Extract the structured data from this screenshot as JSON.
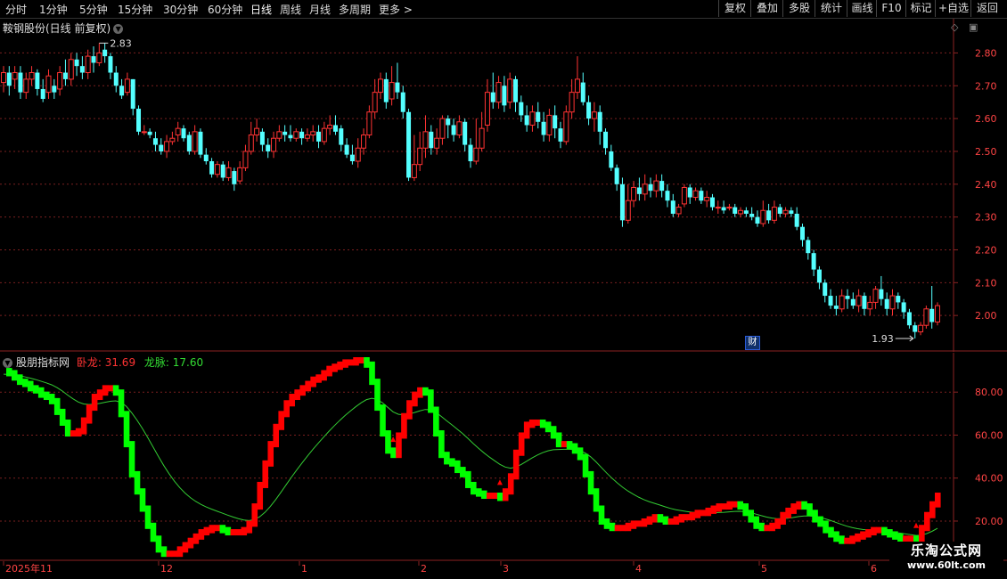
{
  "toolbar": {
    "periods": [
      "分时",
      "1分钟",
      "5分钟",
      "15分钟",
      "30分钟",
      "60分钟",
      "日线",
      "周线",
      "月线",
      "多周期",
      "更多 >"
    ],
    "active_period": "日线",
    "right_buttons": [
      "复权",
      "叠加",
      "多股",
      "统计",
      "画线",
      "F10",
      "标记",
      "+自选",
      "返回"
    ]
  },
  "main_chart": {
    "stock_title": "鞍钢股份(日线 前复权)",
    "high_label": "2.83",
    "low_label": "1.93",
    "marker_label": "财",
    "price_axis": [
      "2.80",
      "2.70",
      "2.60",
      "2.50",
      "2.40",
      "2.30",
      "2.20",
      "2.10",
      "2.00"
    ],
    "candles": [
      [
        2.71,
        2.74,
        2.68,
        2.76
      ],
      [
        2.74,
        2.7,
        2.67,
        2.76
      ],
      [
        2.72,
        2.74,
        2.69,
        2.76
      ],
      [
        2.74,
        2.68,
        2.66,
        2.76
      ],
      [
        2.68,
        2.72,
        2.66,
        2.74
      ],
      [
        2.72,
        2.74,
        2.7,
        2.76
      ],
      [
        2.74,
        2.69,
        2.67,
        2.75
      ],
      [
        2.69,
        2.66,
        2.65,
        2.72
      ],
      [
        2.68,
        2.73,
        2.66,
        2.75
      ],
      [
        2.7,
        2.68,
        2.66,
        2.72
      ],
      [
        2.69,
        2.74,
        2.67,
        2.76
      ],
      [
        2.74,
        2.72,
        2.7,
        2.78
      ],
      [
        2.72,
        2.78,
        2.7,
        2.8
      ],
      [
        2.78,
        2.76,
        2.73,
        2.8
      ],
      [
        2.76,
        2.74,
        2.72,
        2.79
      ],
      [
        2.74,
        2.79,
        2.72,
        2.81
      ],
      [
        2.79,
        2.77,
        2.74,
        2.82
      ],
      [
        2.77,
        2.8,
        2.76,
        2.83
      ],
      [
        2.81,
        2.79,
        2.77,
        2.83
      ],
      [
        2.79,
        2.74,
        2.72,
        2.8
      ],
      [
        2.74,
        2.7,
        2.68,
        2.76
      ],
      [
        2.7,
        2.67,
        2.66,
        2.72
      ],
      [
        2.68,
        2.72,
        2.67,
        2.74
      ],
      [
        2.72,
        2.63,
        2.61,
        2.72
      ],
      [
        2.63,
        2.56,
        2.55,
        2.64
      ],
      [
        2.56,
        2.56,
        2.55,
        2.58
      ],
      [
        2.56,
        2.55,
        2.54,
        2.57
      ],
      [
        2.54,
        2.52,
        2.5,
        2.56
      ],
      [
        2.52,
        2.5,
        2.49,
        2.54
      ],
      [
        2.5,
        2.53,
        2.48,
        2.55
      ],
      [
        2.53,
        2.54,
        2.52,
        2.56
      ],
      [
        2.55,
        2.57,
        2.53,
        2.59
      ],
      [
        2.57,
        2.54,
        2.53,
        2.58
      ],
      [
        2.55,
        2.5,
        2.49,
        2.56
      ],
      [
        2.5,
        2.56,
        2.49,
        2.58
      ],
      [
        2.56,
        2.49,
        2.48,
        2.57
      ],
      [
        2.49,
        2.47,
        2.46,
        2.51
      ],
      [
        2.47,
        2.43,
        2.42,
        2.48
      ],
      [
        2.43,
        2.46,
        2.42,
        2.47
      ],
      [
        2.46,
        2.42,
        2.41,
        2.47
      ],
      [
        2.42,
        2.45,
        2.41,
        2.47
      ],
      [
        2.44,
        2.4,
        2.38,
        2.45
      ],
      [
        2.41,
        2.45,
        2.4,
        2.47
      ],
      [
        2.45,
        2.5,
        2.44,
        2.52
      ],
      [
        2.5,
        2.55,
        2.49,
        2.59
      ],
      [
        2.55,
        2.57,
        2.53,
        2.6
      ],
      [
        2.56,
        2.52,
        2.5,
        2.57
      ],
      [
        2.52,
        2.5,
        2.48,
        2.54
      ],
      [
        2.5,
        2.54,
        2.48,
        2.56
      ],
      [
        2.54,
        2.56,
        2.53,
        2.58
      ],
      [
        2.56,
        2.55,
        2.53,
        2.58
      ],
      [
        2.55,
        2.54,
        2.53,
        2.58
      ],
      [
        2.54,
        2.56,
        2.53,
        2.57
      ],
      [
        2.56,
        2.54,
        2.52,
        2.57
      ],
      [
        2.54,
        2.55,
        2.53,
        2.57
      ],
      [
        2.55,
        2.56,
        2.53,
        2.58
      ],
      [
        2.56,
        2.53,
        2.51,
        2.58
      ],
      [
        2.53,
        2.57,
        2.52,
        2.59
      ],
      [
        2.57,
        2.58,
        2.55,
        2.61
      ],
      [
        2.58,
        2.56,
        2.55,
        2.61
      ],
      [
        2.57,
        2.52,
        2.5,
        2.58
      ],
      [
        2.52,
        2.49,
        2.48,
        2.54
      ],
      [
        2.49,
        2.47,
        2.46,
        2.52
      ],
      [
        2.47,
        2.51,
        2.45,
        2.54
      ],
      [
        2.51,
        2.55,
        2.49,
        2.57
      ],
      [
        2.55,
        2.62,
        2.54,
        2.64
      ],
      [
        2.62,
        2.68,
        2.6,
        2.72
      ],
      [
        2.68,
        2.72,
        2.66,
        2.74
      ],
      [
        2.72,
        2.65,
        2.63,
        2.74
      ],
      [
        2.66,
        2.71,
        2.64,
        2.76
      ],
      [
        2.71,
        2.68,
        2.66,
        2.77
      ],
      [
        2.68,
        2.62,
        2.6,
        2.7
      ],
      [
        2.62,
        2.42,
        2.41,
        2.63
      ],
      [
        2.42,
        2.46,
        2.41,
        2.55
      ],
      [
        2.46,
        2.51,
        2.44,
        2.56
      ],
      [
        2.51,
        2.56,
        2.48,
        2.61
      ],
      [
        2.56,
        2.51,
        2.49,
        2.58
      ],
      [
        2.51,
        2.54,
        2.49,
        2.57
      ],
      [
        2.54,
        2.6,
        2.52,
        2.61
      ],
      [
        2.6,
        2.58,
        2.54,
        2.61
      ],
      [
        2.58,
        2.55,
        2.53,
        2.6
      ],
      [
        2.55,
        2.59,
        2.54,
        2.61
      ],
      [
        2.59,
        2.52,
        2.5,
        2.6
      ],
      [
        2.52,
        2.47,
        2.45,
        2.54
      ],
      [
        2.47,
        2.51,
        2.46,
        2.6
      ],
      [
        2.51,
        2.57,
        2.5,
        2.62
      ],
      [
        2.58,
        2.68,
        2.56,
        2.72
      ],
      [
        2.68,
        2.65,
        2.63,
        2.74
      ],
      [
        2.65,
        2.71,
        2.63,
        2.73
      ],
      [
        2.7,
        2.64,
        2.62,
        2.73
      ],
      [
        2.65,
        2.72,
        2.63,
        2.74
      ],
      [
        2.72,
        2.65,
        2.62,
        2.73
      ],
      [
        2.65,
        2.61,
        2.59,
        2.67
      ],
      [
        2.61,
        2.58,
        2.56,
        2.64
      ],
      [
        2.58,
        2.62,
        2.56,
        2.64
      ],
      [
        2.62,
        2.59,
        2.57,
        2.65
      ],
      [
        2.59,
        2.55,
        2.53,
        2.62
      ],
      [
        2.55,
        2.61,
        2.53,
        2.63
      ],
      [
        2.61,
        2.57,
        2.54,
        2.64
      ],
      [
        2.57,
        2.53,
        2.51,
        2.59
      ],
      [
        2.53,
        2.62,
        2.52,
        2.64
      ],
      [
        2.62,
        2.68,
        2.6,
        2.72
      ],
      [
        2.68,
        2.72,
        2.66,
        2.79
      ],
      [
        2.71,
        2.65,
        2.64,
        2.74
      ],
      [
        2.65,
        2.6,
        2.58,
        2.67
      ],
      [
        2.6,
        2.62,
        2.56,
        2.65
      ],
      [
        2.62,
        2.56,
        2.52,
        2.64
      ],
      [
        2.56,
        2.51,
        2.49,
        2.57
      ],
      [
        2.5,
        2.45,
        2.44,
        2.52
      ],
      [
        2.45,
        2.4,
        2.38,
        2.46
      ],
      [
        2.4,
        2.29,
        2.27,
        2.42
      ],
      [
        2.29,
        2.35,
        2.28,
        2.4
      ],
      [
        2.35,
        2.39,
        2.33,
        2.41
      ],
      [
        2.39,
        2.37,
        2.35,
        2.42
      ],
      [
        2.37,
        2.4,
        2.35,
        2.43
      ],
      [
        2.4,
        2.38,
        2.36,
        2.42
      ],
      [
        2.38,
        2.41,
        2.36,
        2.43
      ],
      [
        2.41,
        2.38,
        2.36,
        2.43
      ],
      [
        2.38,
        2.35,
        2.33,
        2.4
      ],
      [
        2.35,
        2.31,
        2.3,
        2.37
      ],
      [
        2.31,
        2.33,
        2.3,
        2.34
      ],
      [
        2.34,
        2.39,
        2.33,
        2.4
      ],
      [
        2.39,
        2.36,
        2.34,
        2.4
      ],
      [
        2.36,
        2.38,
        2.35,
        2.39
      ],
      [
        2.38,
        2.35,
        2.34,
        2.39
      ],
      [
        2.35,
        2.36,
        2.33,
        2.38
      ],
      [
        2.36,
        2.33,
        2.32,
        2.37
      ],
      [
        2.33,
        2.33,
        2.31,
        2.35
      ],
      [
        2.33,
        2.32,
        2.31,
        2.35
      ],
      [
        2.33,
        2.33,
        2.32,
        2.34
      ],
      [
        2.33,
        2.31,
        2.3,
        2.34
      ],
      [
        2.31,
        2.32,
        2.3,
        2.33
      ],
      [
        2.32,
        2.31,
        2.3,
        2.33
      ],
      [
        2.31,
        2.3,
        2.29,
        2.33
      ],
      [
        2.3,
        2.28,
        2.27,
        2.32
      ],
      [
        2.28,
        2.32,
        2.27,
        2.35
      ],
      [
        2.32,
        2.29,
        2.28,
        2.34
      ],
      [
        2.29,
        2.33,
        2.28,
        2.35
      ],
      [
        2.33,
        2.31,
        2.3,
        2.34
      ],
      [
        2.31,
        2.32,
        2.3,
        2.33
      ],
      [
        2.32,
        2.31,
        2.3,
        2.33
      ],
      [
        2.31,
        2.27,
        2.26,
        2.33
      ],
      [
        2.27,
        2.23,
        2.21,
        2.28
      ],
      [
        2.23,
        2.19,
        2.17,
        2.24
      ],
      [
        2.19,
        2.14,
        2.12,
        2.2
      ],
      [
        2.14,
        2.1,
        2.08,
        2.15
      ],
      [
        2.1,
        2.06,
        2.04,
        2.11
      ],
      [
        2.06,
        2.03,
        2.02,
        2.08
      ],
      [
        2.03,
        2.02,
        2.0,
        2.06
      ],
      [
        2.02,
        2.06,
        2.01,
        2.08
      ],
      [
        2.06,
        2.05,
        2.02,
        2.08
      ],
      [
        2.05,
        2.03,
        2.02,
        2.07
      ],
      [
        2.03,
        2.06,
        2.01,
        2.08
      ],
      [
        2.06,
        2.02,
        2.0,
        2.07
      ],
      [
        2.02,
        2.04,
        2.0,
        2.06
      ],
      [
        2.04,
        2.08,
        2.02,
        2.09
      ],
      [
        2.08,
        2.05,
        2.03,
        2.12
      ],
      [
        2.05,
        2.02,
        2.0,
        2.07
      ],
      [
        2.02,
        2.06,
        2.0,
        2.08
      ],
      [
        2.06,
        2.04,
        2.02,
        2.07
      ],
      [
        2.04,
        2.01,
        1.99,
        2.05
      ],
      [
        2.01,
        1.97,
        1.96,
        2.02
      ],
      [
        1.97,
        1.95,
        1.93,
        1.98
      ],
      [
        1.95,
        1.97,
        1.94,
        1.98
      ],
      [
        1.97,
        2.02,
        1.96,
        2.03
      ],
      [
        2.02,
        1.98,
        1.96,
        2.09
      ],
      [
        1.98,
        2.03,
        1.97,
        2.04
      ]
    ]
  },
  "sub_chart": {
    "indicator_name": "股朋指标网",
    "line1_label": "卧龙:",
    "line1_value": "31.69",
    "line2_label": "龙脉:",
    "line2_value": "17.60",
    "axis": [
      "80.00",
      "60.00",
      "40.00",
      "20.00"
    ],
    "wolong": [
      90,
      89,
      87,
      85,
      84,
      82,
      81,
      79,
      78,
      76,
      71,
      66,
      61,
      61,
      62,
      67,
      73,
      78,
      80,
      82,
      82,
      80,
      70,
      56,
      42,
      34,
      26,
      18,
      12,
      7,
      5,
      5,
      5,
      7,
      9,
      11,
      13,
      15,
      16,
      17,
      17,
      16,
      15,
      15,
      15,
      16,
      19,
      27,
      37,
      47,
      56,
      64,
      70,
      75,
      78,
      80,
      82,
      84,
      86,
      87,
      89,
      91,
      92,
      93,
      94,
      94,
      95,
      95,
      93,
      85,
      73,
      61,
      53,
      51,
      60,
      69,
      75,
      79,
      81,
      80,
      72,
      61,
      51,
      48,
      47,
      44,
      42,
      37,
      34,
      33,
      32,
      32,
      32,
      31,
      34,
      41,
      52,
      60,
      65,
      66,
      66,
      65,
      63,
      60,
      56,
      56,
      55,
      53,
      50,
      42,
      34,
      26,
      20,
      18,
      17,
      17,
      17,
      18,
      19,
      19,
      20,
      21,
      22,
      21,
      20,
      20,
      21,
      22,
      22,
      23,
      24,
      24,
      25,
      26,
      27,
      27,
      28,
      28,
      27,
      24,
      21,
      18,
      17,
      17,
      18,
      20,
      23,
      25,
      27,
      28,
      27,
      24,
      21,
      19,
      16,
      14,
      12,
      11,
      11,
      12,
      13,
      14,
      15,
      16,
      16,
      15,
      14,
      13,
      12,
      12,
      12,
      11,
      17,
      23,
      28,
      32
    ]
  },
  "time_axis": [
    "2025年11",
    "12",
    "1",
    "2",
    "3",
    "4",
    "5",
    "6"
  ],
  "watermark": {
    "line1": "乐淘公式网",
    "line2": "www.60lt.com"
  },
  "colors": {
    "up": "#ff3333",
    "down": "#54ffff",
    "grid": "#7a1f1f",
    "axis_text": "#ff4444",
    "ma_line": "#33cc33",
    "green_bar": "#00ff00",
    "red_bar": "#ff0000"
  }
}
